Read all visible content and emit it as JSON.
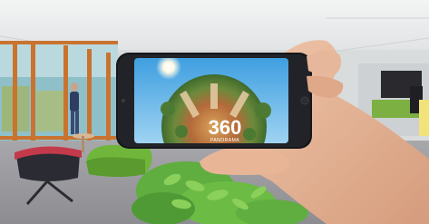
{
  "photo": {
    "phone_screen": {
      "logo_text": "360",
      "logo_subtext": "PANORAMA"
    },
    "colors": {
      "ceiling": "#e9ebec",
      "floor": "#9a9a9e",
      "window_frame": "#c9732f",
      "window_glass": "#8fc0c9",
      "chair_green": "#6fb63a",
      "chair_dark": "#2b2c33",
      "plant_green": "#5fae3f",
      "phone_body": "#16171a",
      "sky_blue": "#5fb4e8",
      "hand_skin": "#e6b79a"
    }
  }
}
